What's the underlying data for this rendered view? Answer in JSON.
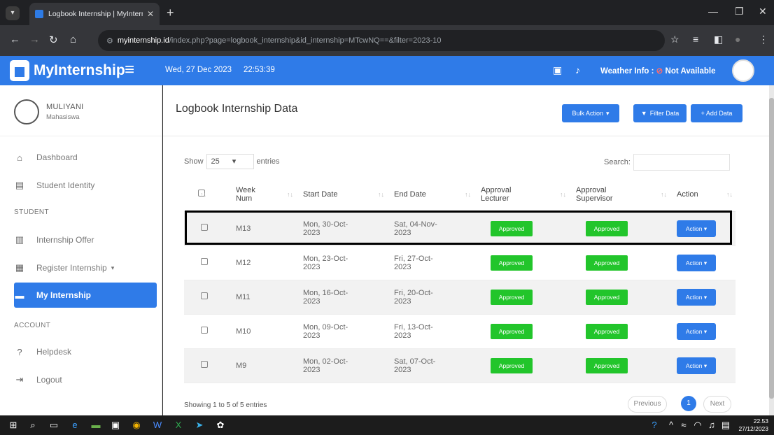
{
  "browser": {
    "tab_title": "Logbook Internship | MyIntern",
    "url_site": "myinternship.id",
    "url_path": "/index.php?page=logbook_internship&id_internship=MTcwNQ==&filter=2023-10"
  },
  "header": {
    "brand": "MyInternship",
    "date": "Wed, 27 Dec 2023",
    "time": "22:53:39",
    "weather_label": "Weather Info :",
    "weather_value": "Not Available"
  },
  "sidebar": {
    "user_name": "MULIYANI",
    "user_role": "Mahasiswa",
    "items": [
      {
        "label": "Dashboard",
        "icon": "home-icon"
      },
      {
        "label": "Student Identity",
        "icon": "id-card-icon"
      },
      {
        "label": "Internship Offer",
        "icon": "building-icon"
      },
      {
        "label": "Register Internship",
        "icon": "form-icon"
      },
      {
        "label": "My Internship",
        "icon": "briefcase-icon"
      },
      {
        "label": "Helpdesk",
        "icon": "question-icon"
      },
      {
        "label": "Logout",
        "icon": "logout-icon"
      }
    ],
    "sections": {
      "student": "STUDENT",
      "account": "ACCOUNT"
    }
  },
  "page": {
    "title": "Logbook Internship Data",
    "bulk_action": "Bulk Action",
    "filter_data": "Filter Data",
    "add_data": "+ Add Data",
    "show_label": "Show",
    "entries_value": "25",
    "entries_label": "entries",
    "search_label": "Search:",
    "footer_info": "Showing 1 to 5 of 5 entries",
    "prev": "Previous",
    "page_num": "1",
    "next": "Next"
  },
  "table": {
    "headers": {
      "week_a": "Week",
      "week_b": "Num",
      "start": "Start Date",
      "end": "End Date",
      "appr_lect_a": "Approval",
      "appr_lect_b": "Lecturer",
      "appr_sup_a": "Approval",
      "appr_sup_b": "Supervisor",
      "action": "Action"
    },
    "rows": [
      {
        "week": "M13",
        "start_a": "Mon, 30-Oct-",
        "start_b": "2023",
        "end_a": "Sat, 04-Nov-",
        "end_b": "2023",
        "lect": "Approved",
        "sup": "Approved",
        "action": "Action"
      },
      {
        "week": "M12",
        "start_a": "Mon, 23-Oct-",
        "start_b": "2023",
        "end_a": "Fri, 27-Oct-",
        "end_b": "2023",
        "lect": "Approved",
        "sup": "Approved",
        "action": "Action"
      },
      {
        "week": "M11",
        "start_a": "Mon, 16-Oct-",
        "start_b": "2023",
        "end_a": "Fri, 20-Oct-",
        "end_b": "2023",
        "lect": "Approved",
        "sup": "Approved",
        "action": "Action"
      },
      {
        "week": "M10",
        "start_a": "Mon, 09-Oct-",
        "start_b": "2023",
        "end_a": "Fri, 13-Oct-",
        "end_b": "2023",
        "lect": "Approved",
        "sup": "Approved",
        "action": "Action"
      },
      {
        "week": "M9",
        "start_a": "Mon, 02-Oct-",
        "start_b": "2023",
        "end_a": "Sat, 07-Oct-",
        "end_b": "2023",
        "lect": "Approved",
        "sup": "Approved",
        "action": "Action"
      }
    ]
  },
  "taskbar": {
    "time": "22.53",
    "date": "27/12/2023"
  },
  "colors": {
    "accent": "#2f7be8",
    "approved": "#22c52b"
  }
}
